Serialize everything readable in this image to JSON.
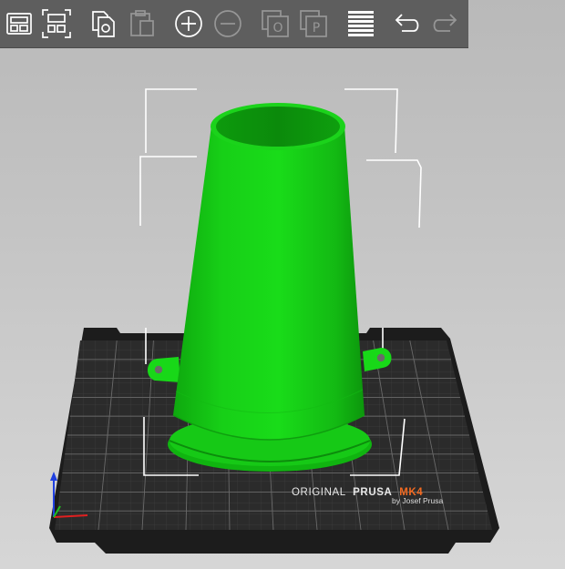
{
  "toolbar": {
    "buttons": [
      {
        "id": "arrange",
        "icon": "arrange-icon",
        "enabled": true
      },
      {
        "id": "arrange-selection",
        "icon": "arrange-selection-icon",
        "enabled": true
      },
      {
        "id": "copy",
        "icon": "copy-icon",
        "enabled": true
      },
      {
        "id": "paste",
        "icon": "paste-icon",
        "enabled": false
      },
      {
        "id": "add-instance",
        "icon": "add-instance-icon",
        "enabled": true
      },
      {
        "id": "remove-instance",
        "icon": "remove-instance-icon",
        "enabled": false
      },
      {
        "id": "split-to-objects",
        "icon": "split-objects-icon",
        "enabled": false,
        "glyph": "O"
      },
      {
        "id": "split-to-parts",
        "icon": "split-parts-icon",
        "enabled": false,
        "glyph": "P"
      },
      {
        "id": "variable-layer-height",
        "icon": "layers-icon",
        "enabled": true
      },
      {
        "id": "undo",
        "icon": "undo-icon",
        "enabled": true
      },
      {
        "id": "redo",
        "icon": "redo-icon",
        "enabled": false
      }
    ]
  },
  "bed": {
    "brand_original": "ORIGINAL",
    "brand_prusa": "PRUSA",
    "brand_model": "MK4",
    "brand_by": "by Josef Prusa",
    "sheet_color": "#2b2b2b",
    "frame_color": "#1c1c1c",
    "accent_color": "#f26a21"
  },
  "model": {
    "name": "cone",
    "color": "#18d818",
    "selected": true
  },
  "axes": {
    "x_color": "#e02020",
    "y_color": "#20c020",
    "z_color": "#2040e0"
  }
}
